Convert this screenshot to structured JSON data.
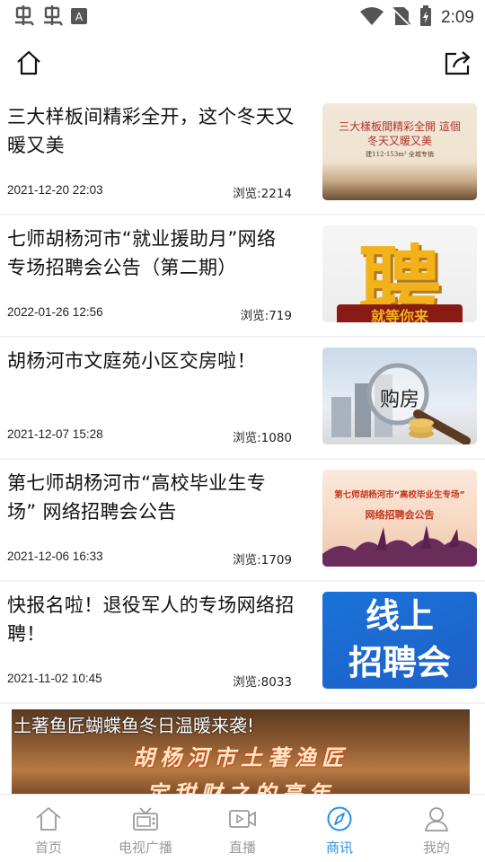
{
  "status_bar": {
    "time": "2:09",
    "icons": [
      "app-notification-icon",
      "app-notification-icon",
      "text-a-icon",
      "wifi-icon",
      "no-sim-icon",
      "battery-charging-icon"
    ]
  },
  "top_bar": {
    "home_icon": "home-icon",
    "share_icon": "share-icon"
  },
  "news": [
    {
      "title": "三大样板间精彩全开，这个冬天又暖又美",
      "date": "2021-12-20 22:03",
      "views": "浏览:2214",
      "thumb_text": "三大樣板間精彩全開 這個冬天又暖又美",
      "thumb_sub": "建112-153m² 全城专销"
    },
    {
      "title": "七师胡杨河市“就业援助月”网络专场招聘会公告（第二期）",
      "date": "2022-01-26 12:56",
      "views": "浏览:719",
      "thumb_text": "聘",
      "thumb_sub": "就等你来"
    },
    {
      "title": "胡杨河市文庭苑小区交房啦！",
      "date": "2021-12-07 15:28",
      "views": "浏览:1080",
      "thumb_text": "购房",
      "thumb_sub": ""
    },
    {
      "title": "第七师胡杨河市“高校毕业生专场” 网络招聘会公告",
      "date": "2021-12-06 16:33",
      "views": "浏览:1709",
      "thumb_text": "第七师胡杨河市“高校毕业生专场”",
      "thumb_sub": "网络招聘会公告"
    },
    {
      "title": "快报名啦！退役军人的专场网络招聘！",
      "date": "2021-11-02 10:45",
      "views": "浏览:8033",
      "thumb_text": "线上",
      "thumb_sub": "招聘会"
    }
  ],
  "banner": {
    "title": "土著鱼匠蝴蝶鱼冬日温暖来袭!",
    "subtitle": "胡杨河市土著渔匠",
    "subtitle2": "定甜财之的高年"
  },
  "bottom_nav": [
    {
      "label": "首页",
      "icon": "home-icon",
      "active": false
    },
    {
      "label": "电视广播",
      "icon": "tv-icon",
      "active": false
    },
    {
      "label": "直播",
      "icon": "live-video-icon",
      "active": false
    },
    {
      "label": "商讯",
      "icon": "compass-icon",
      "active": true
    },
    {
      "label": "我的",
      "icon": "user-icon",
      "active": false
    }
  ],
  "colors": {
    "accent": "#2a8fe0",
    "nav_inactive": "#9a9a9a"
  }
}
